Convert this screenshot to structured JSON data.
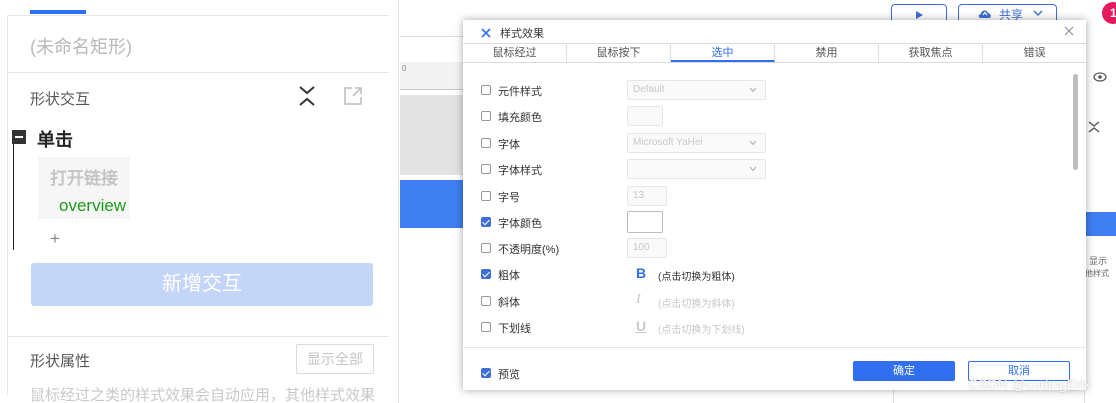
{
  "left_panel": {
    "shape_name": "(未命名矩形)",
    "interaction_section_title": "形状交互",
    "event_label": "单击",
    "action_label": "打开链接",
    "target_label": "overview",
    "add_symbol": "+",
    "add_interaction_button": "新增交互",
    "properties_title": "形状属性",
    "show_all_button": "显示全部",
    "properties_description": "鼠标经过之类的样式效果会自动应用，其他样式效果"
  },
  "toolbar": {
    "share_label": "共享",
    "badge_text": "1"
  },
  "right_strip": {
    "text_1": "显示",
    "text_2": "他样式"
  },
  "dialog": {
    "title": "样式效果",
    "tabs": [
      {
        "label": "鼠标经过"
      },
      {
        "label": "鼠标按下"
      },
      {
        "label": "选中"
      },
      {
        "label": "禁用"
      },
      {
        "label": "获取焦点"
      },
      {
        "label": "错误"
      }
    ],
    "active_tab_index": 2,
    "rows": {
      "element_style": {
        "label": "元件样式",
        "checked": false,
        "value": "Default"
      },
      "fill_color": {
        "label": "填充颜色",
        "checked": false
      },
      "font": {
        "label": "字体",
        "checked": false,
        "value": "Microsoft YaHei"
      },
      "font_style": {
        "label": "字体样式",
        "checked": false,
        "value": ""
      },
      "font_size": {
        "label": "字号",
        "checked": false,
        "value": "13"
      },
      "font_color": {
        "label": "字体颜色",
        "checked": true
      },
      "opacity": {
        "label": "不透明度(%)",
        "checked": false,
        "value": "100"
      },
      "bold": {
        "label": "粗体",
        "checked": true,
        "icon": "B",
        "hint": "(点击切换为粗体)"
      },
      "italic": {
        "label": "斜体",
        "checked": false,
        "icon": "I",
        "hint": "(点击切换为斜体)"
      },
      "underline": {
        "label": "下划线",
        "checked": false,
        "icon": "U",
        "hint": "(点击切换为下划线)"
      }
    },
    "preview": {
      "label": "预览",
      "checked": true
    },
    "ok_button": "确定",
    "cancel_button": "取消"
  },
  "watermark": "CSDN @codingErix",
  "colors": {
    "accent": "#2f6ff0",
    "add_button_bg": "#c3d6f8",
    "target_link": "#1b9a1b",
    "badge": "#e6195f"
  }
}
